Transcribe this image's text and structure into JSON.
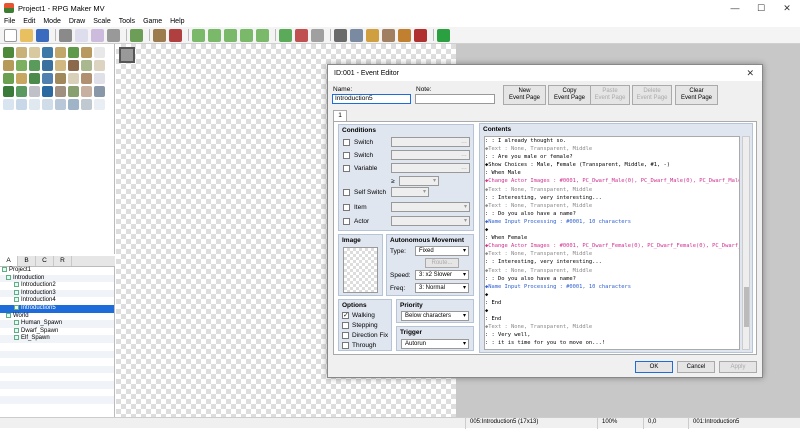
{
  "window": {
    "title": "Project1 - RPG Maker MV",
    "min": "—",
    "max": "☐",
    "close": "✕"
  },
  "menu": [
    "File",
    "Edit",
    "Mode",
    "Draw",
    "Scale",
    "Tools",
    "Game",
    "Help"
  ],
  "tileset_tabs": [
    "A",
    "B",
    "C",
    "R"
  ],
  "map_tree": [
    {
      "label": "Project1",
      "level": 0
    },
    {
      "label": "Introduction",
      "level": 1
    },
    {
      "label": "Introduction2",
      "level": 2
    },
    {
      "label": "Introduction3",
      "level": 2
    },
    {
      "label": "Introduction4",
      "level": 2
    },
    {
      "label": "Introduction5",
      "level": 2,
      "selected": true
    },
    {
      "label": "World",
      "level": 1
    },
    {
      "label": "Human_Spawn",
      "level": 2
    },
    {
      "label": "Dwarf_Spawn",
      "level": 2
    },
    {
      "label": "Elf_Spawn",
      "level": 2
    }
  ],
  "status": {
    "map": "005:Introduction5 (17x13)",
    "zoom": "100%",
    "coords": "0,0",
    "event": "001:Introduction5"
  },
  "dialog": {
    "title": "ID:001 - Event Editor",
    "name_label": "Name:",
    "name_value": "Introduction5",
    "note_label": "Note:",
    "note_value": "",
    "buttons": {
      "new": "New\nEvent Page",
      "copy": "Copy\nEvent Page",
      "paste": "Paste\nEvent Page",
      "delete": "Delete\nEvent Page",
      "clear": "Clear\nEvent Page"
    },
    "page_tab": "1",
    "conditions": {
      "title": "Conditions",
      "switch1": "Switch",
      "switch2": "Switch",
      "variable": "Variable",
      "ge": "≥",
      "self_switch": "Self Switch",
      "item": "Item",
      "actor": "Actor"
    },
    "image": {
      "title": "Image"
    },
    "auto": {
      "title": "Autonomous Movement",
      "type_label": "Type:",
      "type_value": "Fixed",
      "route": "Route...",
      "speed_label": "Speed:",
      "speed_value": "3: x2 Slower",
      "freq_label": "Freq:",
      "freq_value": "3: Normal"
    },
    "options": {
      "title": "Options",
      "walking": "Walking",
      "stepping": "Stepping",
      "direction_fix": "Direction Fix",
      "through": "Through"
    },
    "priority": {
      "title": "Priority",
      "value": "Below characters"
    },
    "trigger": {
      "title": "Trigger",
      "value": "Autorun"
    },
    "contents_title": "Contents",
    "contents": [
      {
        "t": "   :         : I already thought so.",
        "c": ""
      },
      {
        "t": "   ◆Text : None, Transparent, Middle",
        "c": "dim"
      },
      {
        "t": "   :     : Are you male or female?",
        "c": ""
      },
      {
        "t": "  ◆Show Choices : Male, Female (Transparent, Middle, #1, -)",
        "c": ""
      },
      {
        "t": "  : When Male",
        "c": ""
      },
      {
        "t": "   ◆Change Actor Images : #0001, PC_Dwarf_Male(0), PC_Dwarf_Male(0), PC_Dwarf_Male",
        "c": "pink"
      },
      {
        "t": "   ◆Text : None, Transparent, Middle",
        "c": "dim"
      },
      {
        "t": "   :     : Interesting, very interesting...",
        "c": ""
      },
      {
        "t": "   ◆Text : None, Transparent, Middle",
        "c": "dim"
      },
      {
        "t": "   :     : Do you also have a name?",
        "c": ""
      },
      {
        "t": "   ◆Name Input Processing : #0001, 10 characters",
        "c": "blue"
      },
      {
        "t": "   ◆",
        "c": ""
      },
      {
        "t": "  : When Female",
        "c": ""
      },
      {
        "t": "   ◆Change Actor Images : #0001, PC_Dwarf_Female(0), PC_Dwarf_Female(0), PC_Dwarf_Female",
        "c": "pink"
      },
      {
        "t": "   ◆Text : None, Transparent, Middle",
        "c": "dim"
      },
      {
        "t": "   :     : Interesting, very interesting...",
        "c": ""
      },
      {
        "t": "   ◆Text : None, Transparent, Middle",
        "c": "dim"
      },
      {
        "t": "   :     : Do you also have a name?",
        "c": ""
      },
      {
        "t": "   ◆Name Input Processing : #0001, 10 characters",
        "c": "blue"
      },
      {
        "t": "   ◆",
        "c": ""
      },
      {
        "t": "  : End",
        "c": ""
      },
      {
        "t": "  ◆",
        "c": ""
      },
      {
        "t": " : End",
        "c": ""
      },
      {
        "t": " ◆Text : None, Transparent, Middle",
        "c": "dim"
      },
      {
        "t": " :     : Very well,",
        "c": ""
      },
      {
        "t": " :     : it is time for you to move on...!",
        "c": ""
      }
    ],
    "ok": "OK",
    "cancel": "Cancel",
    "apply": "Apply"
  }
}
